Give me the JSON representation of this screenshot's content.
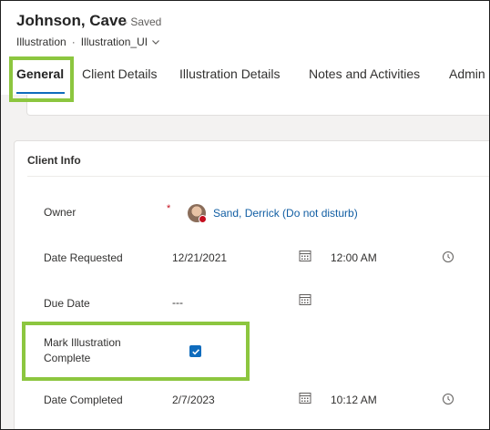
{
  "header": {
    "title": "Johnson, Cave",
    "saved_status": "- Saved",
    "breadcrumb": {
      "entity": "Illustration",
      "separator": "·",
      "form": "Illustration_UI"
    }
  },
  "tabs": [
    {
      "label": "General",
      "active": true
    },
    {
      "label": "Client Details",
      "active": false
    },
    {
      "label": "Illustration Details",
      "active": false
    },
    {
      "label": "Notes and Activities",
      "active": false
    },
    {
      "label": "Admin",
      "active": false
    }
  ],
  "section": {
    "title": "Client Info",
    "fields": {
      "owner": {
        "label": "Owner",
        "required_mark": "*",
        "value": "Sand, Derrick (Do not disturb)"
      },
      "date_requested": {
        "label": "Date Requested",
        "date": "12/21/2021",
        "time": "12:00 AM"
      },
      "due_date": {
        "label": "Due Date",
        "date": "---"
      },
      "mark_complete": {
        "label": "Mark Illustration Complete",
        "checked": true
      },
      "date_completed": {
        "label": "Date Completed",
        "date": "2/7/2023",
        "time": "10:12 AM"
      }
    }
  },
  "icons": {
    "calendar": "calendar-icon",
    "clock": "clock-icon",
    "chevron": "chevron-down-icon"
  },
  "colors": {
    "accent": "#0f6cbd",
    "highlight": "#8cc63f",
    "required": "#c50f1f",
    "link": "#115ea3"
  }
}
